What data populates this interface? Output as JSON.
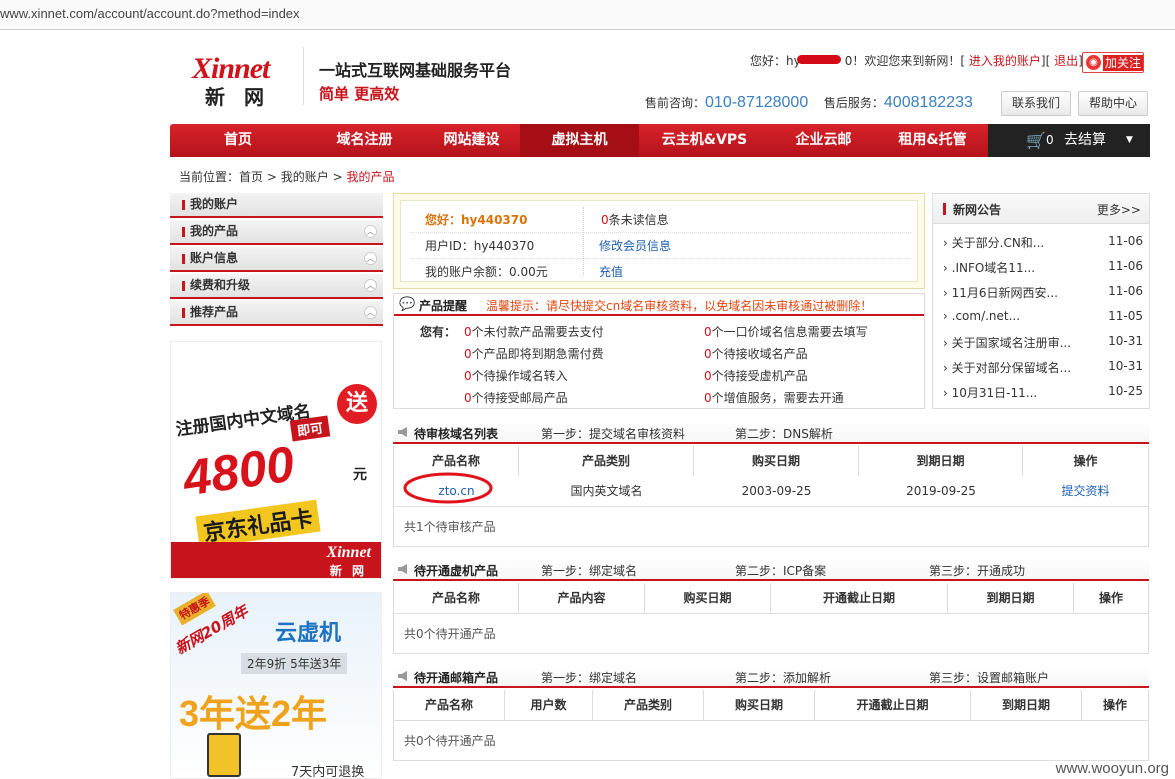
{
  "browser": {
    "url": "www.xinnet.com/account/account.do?method=index"
  },
  "header": {
    "logo_text": "Xinnet",
    "logo_cn": "新 网",
    "slogan_main": "一站式互联网基础服务平台",
    "slogan_sub": "简单  更高效",
    "welcome_prefix": "您好：hy",
    "welcome_suffix": "0！欢迎您来到新网！[",
    "account_link": "进入我的账户",
    "mid": "][",
    "logout": "退出",
    "end": "]",
    "weibo_follow": "加关注",
    "presales_label": "售前咨询：",
    "presales_phone": "010-87128000",
    "aftersales_label": "售后服务：",
    "aftersales_phone": "4008182233",
    "contact_btn": "联系我们",
    "help_btn": "帮助中心"
  },
  "nav": {
    "items": [
      "首页",
      "域名注册",
      "网站建设",
      "虚拟主机",
      "云主机&VPS",
      "企业云邮",
      "租用&托管"
    ],
    "active": "虚拟主机",
    "cart_count": "0",
    "cart_label": "去结算"
  },
  "breadcrumb": {
    "label": "当前位置：",
    "home": "首页",
    "account": "我的账户",
    "current": "我的产品",
    "sep": ">"
  },
  "sidebar": {
    "items": [
      "我的账户",
      "我的产品",
      "账户信息",
      "续费和升级",
      "推荐产品"
    ]
  },
  "ads": {
    "ad1": {
      "line1": "注册国内中文域名",
      "free": "送",
      "line2": "即可",
      "amount": "4800",
      "unit": "元",
      "card": "京东礼品卡",
      "brand": "Xinnet",
      "brand_cn": "新 网"
    },
    "ad2": {
      "badge": "特惠季",
      "anniv": "新网20周年",
      "title": "云虚机",
      "promo": "2年9折  5年送3年",
      "big": "3年送2年",
      "refund": "7天内可退换"
    }
  },
  "account": {
    "greeting": "您好：hy440370",
    "unread_count": "0",
    "unread_label": "条未读信息",
    "user_id": "用户ID：hy440370",
    "edit_member": "修改会员信息",
    "balance": "我的账户余额：0.00元",
    "recharge": "充值"
  },
  "reminder": {
    "title": "产品提醒",
    "warning": "温馨提示：请尽快提交cn域名审核资料，以免域名因未审核通过被删除！",
    "you_have": "您有：",
    "items": [
      {
        "n": "0",
        "t": "个未付款产品需要去支付"
      },
      {
        "n": "0",
        "t": "个一口价域名信息需要去填写"
      },
      {
        "n": "0",
        "t": "个产品即将到期急需付费"
      },
      {
        "n": "0",
        "t": "个待接收域名产品"
      },
      {
        "n": "0",
        "t": "个待操作域名转入"
      },
      {
        "n": "0",
        "t": "个待接受虚机产品"
      },
      {
        "n": "0",
        "t": "个待接受邮局产品"
      },
      {
        "n": "0",
        "t": "个增值服务，需要去开通"
      }
    ]
  },
  "notices": {
    "title": "新网公告",
    "more": "更多>>",
    "items": [
      {
        "t": "关于部分.CN和...",
        "d": "11-06"
      },
      {
        "t": ".INFO域名11...",
        "d": "11-06"
      },
      {
        "t": "11月6日新网西安...",
        "d": "11-06"
      },
      {
        "t": ".com/.net...",
        "d": "11-05"
      },
      {
        "t": "关于国家域名注册审...",
        "d": "10-31"
      },
      {
        "t": "关于对部分保留域名...",
        "d": "10-31"
      },
      {
        "t": "10月31日-11...",
        "d": "10-25"
      }
    ]
  },
  "pending_domains": {
    "title": "待审核域名列表",
    "step1": "第一步：提交域名审核资料",
    "step2": "第二步：DNS解析",
    "headers": [
      "产品名称",
      "产品类别",
      "购买日期",
      "到期日期",
      "操作"
    ],
    "rows": [
      {
        "name": "zto.cn",
        "type": "国内英文域名",
        "buy": "2003-09-25",
        "expire": "2019-09-25",
        "action": "提交资料"
      }
    ],
    "footer": "共1个待审核产品"
  },
  "pending_hosts": {
    "title": "待开通虚机产品",
    "step1": "第一步：绑定域名",
    "step2": "第二步：ICP备案",
    "step3": "第三步：开通成功",
    "headers": [
      "产品名称",
      "产品内容",
      "购买日期",
      "开通截止日期",
      "到期日期",
      "操作"
    ],
    "footer": "共0个待开通产品"
  },
  "pending_mail": {
    "title": "待开通邮箱产品",
    "step1": "第一步：绑定域名",
    "step2": "第二步：添加解析",
    "step3": "第三步：设置邮箱账户",
    "headers": [
      "产品名称",
      "用户数",
      "产品类别",
      "购买日期",
      "开通截止日期",
      "到期日期",
      "操作"
    ],
    "footer": "共0个待开通产品"
  },
  "watermark": "www.wooyun.org",
  "colors": {
    "brand_red": "#c8141c",
    "link_blue": "#3a7fc0"
  }
}
